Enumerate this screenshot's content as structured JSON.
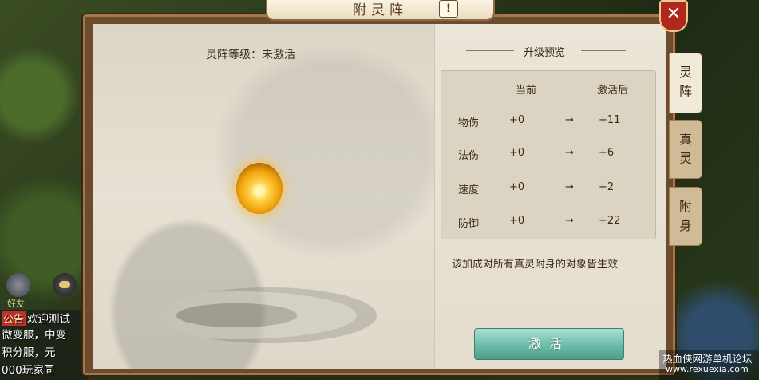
{
  "dialog": {
    "title": "附灵阵",
    "help_label": "!",
    "close_label": "✕"
  },
  "left": {
    "level_text": "灵阵等级：未激活"
  },
  "preview": {
    "title": "升级预览",
    "headers": {
      "current": "当前",
      "after": "激活后"
    },
    "rows": [
      {
        "name": "物伤",
        "current": "+0",
        "arrow": "→",
        "after": "+11"
      },
      {
        "name": "法伤",
        "current": "+0",
        "arrow": "→",
        "after": "+6"
      },
      {
        "name": "速度",
        "current": "+0",
        "arrow": "→",
        "after": "+2"
      },
      {
        "name": "防御",
        "current": "+0",
        "arrow": "→",
        "after": "+22"
      }
    ],
    "note": "该加成对所有真灵附身的对象皆生效",
    "activate_label": "激活"
  },
  "tabs": [
    {
      "label": "灵\n阵"
    },
    {
      "label": "真\n灵"
    },
    {
      "label": "附\n身"
    }
  ],
  "chat": {
    "notice_tag": "公告",
    "lines": [
      "欢迎测试",
      "微变服，中变",
      "积分服，元",
      "000玩家同"
    ]
  },
  "side": {
    "friend_label": "好友"
  },
  "watermark": {
    "title": "热血侠网游单机论坛",
    "url": "www.rexuexia.com"
  }
}
